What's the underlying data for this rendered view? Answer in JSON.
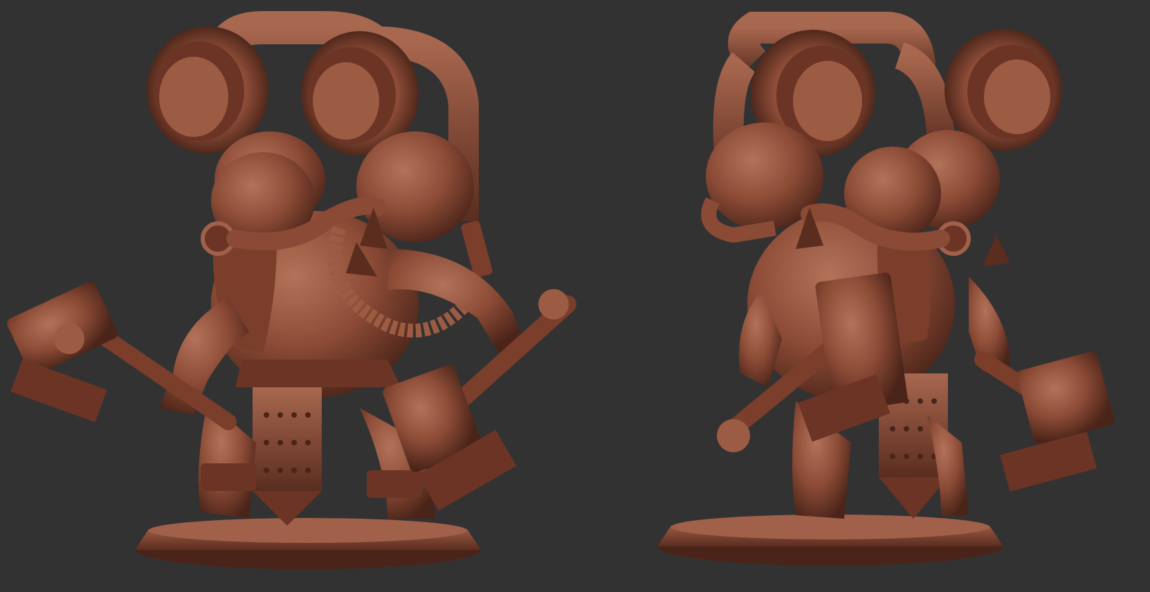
{
  "scene": {
    "background_color": "#323233",
    "material_color": "#8a4a35",
    "highlight_color": "#b3735a",
    "shadow_color": "#4a2419",
    "figures": [
      {
        "name": "dwarf-figure-front-view",
        "facing": "left"
      },
      {
        "name": "dwarf-figure-rear-three-quarter-view",
        "facing": "right"
      }
    ]
  }
}
